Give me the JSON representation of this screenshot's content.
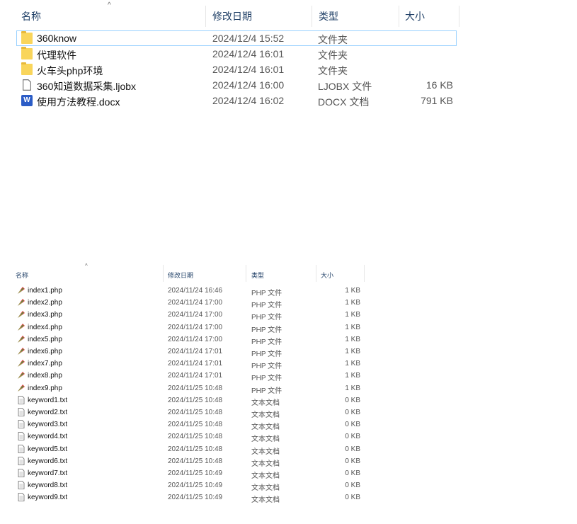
{
  "top_pane": {
    "headers": {
      "name": "名称",
      "modified": "修改日期",
      "type": "类型",
      "size": "大小"
    },
    "sort_indicator": "^",
    "rows": [
      {
        "name": "360know",
        "modified": "2024/12/4 15:52",
        "type": "文件夹",
        "size": "",
        "icon": "folder-icon"
      },
      {
        "name": "代理软件",
        "modified": "2024/12/4 16:01",
        "type": "文件夹",
        "size": "",
        "icon": "folder-icon"
      },
      {
        "name": "火车头php环境",
        "modified": "2024/12/4 16:01",
        "type": "文件夹",
        "size": "",
        "icon": "folder-icon"
      },
      {
        "name": "360知道数据采集.ljobx",
        "modified": "2024/12/4 16:00",
        "type": "LJOBX 文件",
        "size": "16 KB",
        "icon": "file-icon"
      },
      {
        "name": "使用方法教程.docx",
        "modified": "2024/12/4 16:02",
        "type": "DOCX 文档",
        "size": "791 KB",
        "icon": "word-doc-icon"
      }
    ]
  },
  "bottom_pane": {
    "headers": {
      "name": "名称",
      "modified": "修改日期",
      "type": "类型",
      "size": "大小"
    },
    "sort_indicator": "^",
    "rows": [
      {
        "name": "index1.php",
        "modified": "2024/11/24 16:46",
        "type": "PHP 文件",
        "size": "1 KB",
        "icon": "php-file-icon"
      },
      {
        "name": "index2.php",
        "modified": "2024/11/24 17:00",
        "type": "PHP 文件",
        "size": "1 KB",
        "icon": "php-file-icon"
      },
      {
        "name": "index3.php",
        "modified": "2024/11/24 17:00",
        "type": "PHP 文件",
        "size": "1 KB",
        "icon": "php-file-icon"
      },
      {
        "name": "index4.php",
        "modified": "2024/11/24 17:00",
        "type": "PHP 文件",
        "size": "1 KB",
        "icon": "php-file-icon"
      },
      {
        "name": "index5.php",
        "modified": "2024/11/24 17:00",
        "type": "PHP 文件",
        "size": "1 KB",
        "icon": "php-file-icon"
      },
      {
        "name": "index6.php",
        "modified": "2024/11/24 17:01",
        "type": "PHP 文件",
        "size": "1 KB",
        "icon": "php-file-icon"
      },
      {
        "name": "index7.php",
        "modified": "2024/11/24 17:01",
        "type": "PHP 文件",
        "size": "1 KB",
        "icon": "php-file-icon"
      },
      {
        "name": "index8.php",
        "modified": "2024/11/24 17:01",
        "type": "PHP 文件",
        "size": "1 KB",
        "icon": "php-file-icon"
      },
      {
        "name": "index9.php",
        "modified": "2024/11/25 10:48",
        "type": "PHP 文件",
        "size": "1 KB",
        "icon": "php-file-icon"
      },
      {
        "name": "keyword1.txt",
        "modified": "2024/11/25 10:48",
        "type": "文本文档",
        "size": "0 KB",
        "icon": "text-file-icon"
      },
      {
        "name": "keyword2.txt",
        "modified": "2024/11/25 10:48",
        "type": "文本文档",
        "size": "0 KB",
        "icon": "text-file-icon"
      },
      {
        "name": "keyword3.txt",
        "modified": "2024/11/25 10:48",
        "type": "文本文档",
        "size": "0 KB",
        "icon": "text-file-icon"
      },
      {
        "name": "keyword4.txt",
        "modified": "2024/11/25 10:48",
        "type": "文本文档",
        "size": "0 KB",
        "icon": "text-file-icon"
      },
      {
        "name": "keyword5.txt",
        "modified": "2024/11/25 10:48",
        "type": "文本文档",
        "size": "0 KB",
        "icon": "text-file-icon"
      },
      {
        "name": "keyword6.txt",
        "modified": "2024/11/25 10:48",
        "type": "文本文档",
        "size": "0 KB",
        "icon": "text-file-icon"
      },
      {
        "name": "keyword7.txt",
        "modified": "2024/11/25 10:49",
        "type": "文本文档",
        "size": "0 KB",
        "icon": "text-file-icon"
      },
      {
        "name": "keyword8.txt",
        "modified": "2024/11/25 10:49",
        "type": "文本文档",
        "size": "0 KB",
        "icon": "text-file-icon"
      },
      {
        "name": "keyword9.txt",
        "modified": "2024/11/25 10:49",
        "type": "文本文档",
        "size": "0 KB",
        "icon": "text-file-icon"
      }
    ]
  },
  "colors": {
    "header_text": "#1f3f66",
    "selection_border": "#99d1ff",
    "folder": "#f9d55b",
    "word_blue": "#2b5cc6"
  }
}
